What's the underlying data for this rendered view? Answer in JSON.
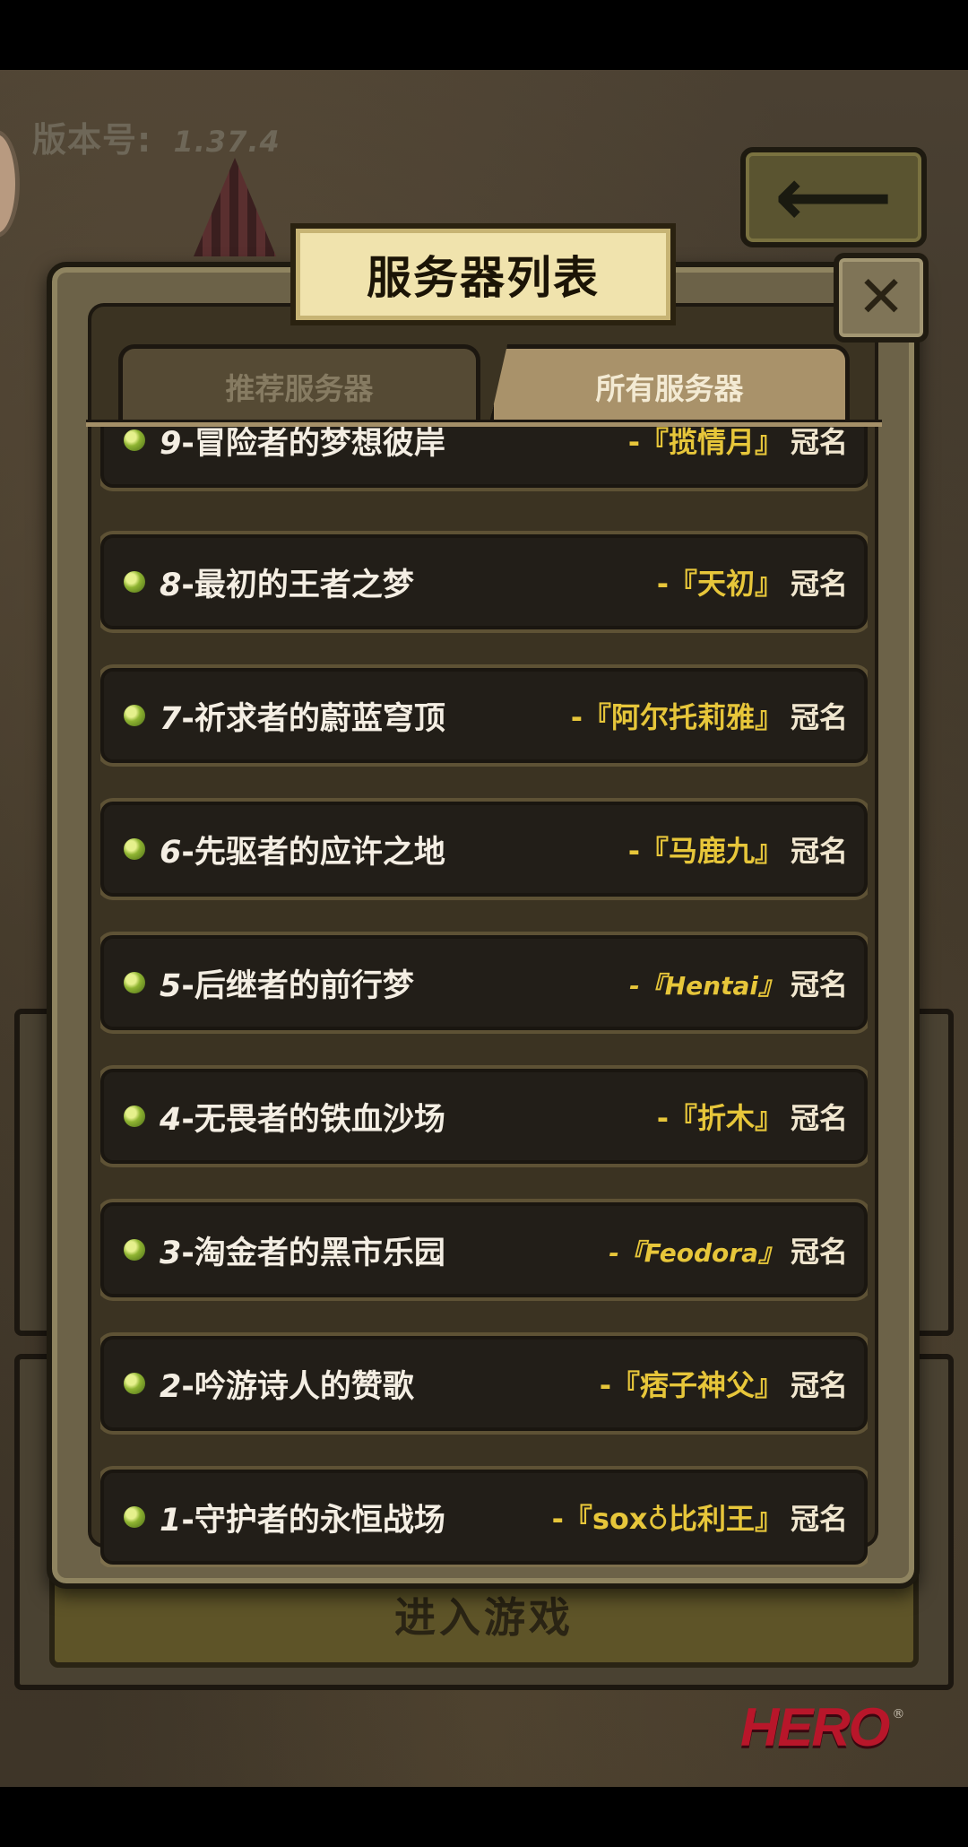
{
  "header": {
    "version_label": "版本号:",
    "version_number": "1.37.4"
  },
  "dialog": {
    "title": "服务器列表",
    "close_symbol": "✕",
    "tabs": [
      {
        "label": "推荐服务器",
        "active": false
      },
      {
        "label": "所有服务器",
        "active": true
      }
    ]
  },
  "servers": [
    {
      "number": "9",
      "name": "-冒险者的梦想彼岸",
      "champion": "-『揽情月』",
      "suffix": "冠名"
    },
    {
      "number": "8",
      "name": "-最初的王者之梦",
      "champion": "-『天初』",
      "suffix": "冠名"
    },
    {
      "number": "7",
      "name": "-祈求者的蔚蓝穹顶",
      "champion": "-『阿尔托莉雅』",
      "suffix": "冠名"
    },
    {
      "number": "6",
      "name": "-先驱者的应许之地",
      "champion": "-『马鹿九』",
      "suffix": "冠名"
    },
    {
      "number": "5",
      "name": "-后继者的前行梦",
      "champion": "-『Hentai』",
      "suffix": "冠名"
    },
    {
      "number": "4",
      "name": "-无畏者的铁血沙场",
      "champion": "-『折木』",
      "suffix": "冠名"
    },
    {
      "number": "3",
      "name": "-淘金者的黑市乐园",
      "champion": "-『Feodora』",
      "suffix": "冠名"
    },
    {
      "number": "2",
      "name": "-吟游诗人的赞歌",
      "champion": "-『痞子神父』",
      "suffix": "冠名"
    },
    {
      "number": "1",
      "name": "-守护者的永恒战场",
      "champion": "-『sox♁比利王』",
      "suffix": "冠名"
    }
  ],
  "background": {
    "enter_game_label": "进入游戏",
    "back_arrow": "⟵",
    "logo_text": "HERO",
    "logo_reg": "®"
  },
  "colors": {
    "champion_gold": "#e7c63a",
    "row_bg": "#221e18",
    "title_plate": "#f0e3ad"
  }
}
